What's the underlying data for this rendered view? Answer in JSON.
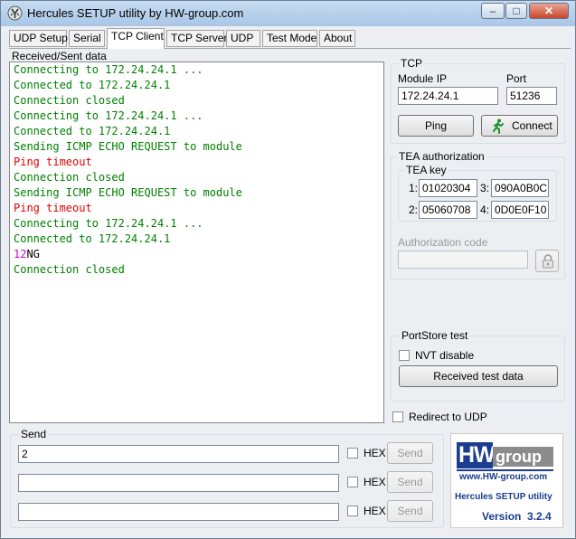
{
  "window": {
    "title": "Hercules SETUP utility by HW-group.com",
    "minimize": "–",
    "maximize": "□",
    "close": "✕"
  },
  "tabs": [
    {
      "label": "UDP Setup"
    },
    {
      "label": "Serial"
    },
    {
      "label": "TCP Client"
    },
    {
      "label": "TCP Server"
    },
    {
      "label": "UDP"
    },
    {
      "label": "Test Mode"
    },
    {
      "label": "About"
    }
  ],
  "log": {
    "label": "Received/Sent data",
    "lines": [
      {
        "text": "Connecting to 172.24.24.1 ...",
        "color": "#008000"
      },
      {
        "text": "Connected to 172.24.24.1",
        "color": "#008000"
      },
      {
        "text": "Connection closed",
        "color": "#008000"
      },
      {
        "text": "Connecting to 172.24.24.1 ...",
        "color": "#008000"
      },
      {
        "text": "Connected to 172.24.24.1",
        "color": "#008000"
      },
      {
        "text": "Sending ICMP ECHO REQUEST to module",
        "color": "#008000"
      },
      {
        "text": "Ping timeout",
        "color": "#e00000"
      },
      {
        "text": "Connection closed",
        "color": "#008000"
      },
      {
        "text": "Sending ICMP ECHO REQUEST to module",
        "color": "#008000"
      },
      {
        "text": "Ping timeout",
        "color": "#e00000"
      },
      {
        "text": "Connecting to 172.24.24.1 ...",
        "color": "#008000"
      },
      {
        "text": "Connected to 172.24.24.1",
        "color": "#008000"
      },
      {
        "text": "12",
        "color": "#d000d0",
        "suffix": "NG",
        "suffix_color": "#000000"
      },
      {
        "text": "Connection closed",
        "color": "#008000"
      }
    ]
  },
  "tcp": {
    "title": "TCP",
    "module_ip_label": "Module IP",
    "module_ip": "172.24.24.1",
    "port_label": "Port",
    "port": "51236",
    "ping_label": "Ping",
    "connect_label": "Connect"
  },
  "tea": {
    "title": "TEA authorization",
    "key_title": "TEA key",
    "keys": [
      {
        "index": "1:",
        "value": "01020304"
      },
      {
        "index": "3:",
        "value": "090A0B0C"
      },
      {
        "index": "2:",
        "value": "05060708"
      },
      {
        "index": "4:",
        "value": "0D0E0F10"
      }
    ],
    "auth_code_label": "Authorization code",
    "auth_code_value": ""
  },
  "portstore": {
    "title": "PortStore test",
    "nvt_label": "NVT disable",
    "received_btn": "Received test data"
  },
  "redirect_label": "Redirect to UDP",
  "send": {
    "title": "Send",
    "rows": [
      {
        "value": "2",
        "hex_label": "HEX",
        "send_label": "Send"
      },
      {
        "value": "",
        "hex_label": "HEX",
        "send_label": "Send"
      },
      {
        "value": "",
        "hex_label": "HEX",
        "send_label": "Send"
      }
    ]
  },
  "logo": {
    "brand_hw": "HW",
    "brand_group": "group",
    "url": "www.HW-group.com",
    "product": "Hercules SETUP utility",
    "version": "Version  3.2.4",
    "colors": {
      "blue": "#1a3d8f",
      "grey": "#8b8b8b",
      "version": "#1a3d8f"
    }
  }
}
